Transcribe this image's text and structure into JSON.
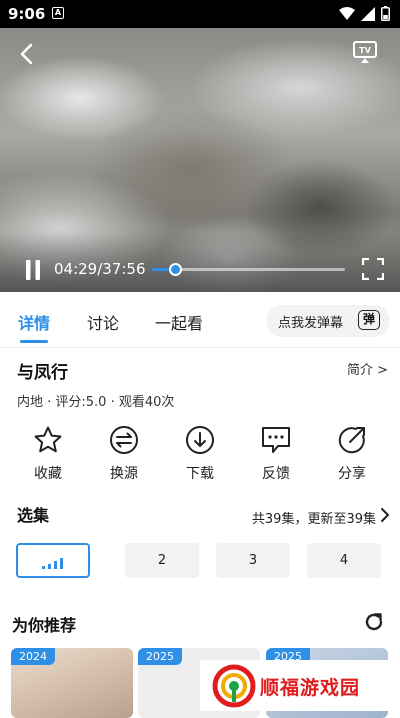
{
  "status_bar": {
    "time": "9:06",
    "notification_icon": "A"
  },
  "player": {
    "time": "04:29/37:56",
    "progress_fraction": 0.118,
    "icons": [
      "back-icon",
      "cast-tv-icon",
      "pause-icon",
      "fullscreen-icon"
    ]
  },
  "tabs": [
    {
      "label": "详情",
      "active": true
    },
    {
      "label": "讨论",
      "active": false
    },
    {
      "label": "一起看",
      "active": false
    }
  ],
  "danmu": {
    "placeholder": "点我发弹幕",
    "badge": "弹"
  },
  "show": {
    "title": "与凤行",
    "intro_link": "简介 >",
    "meta": "内地 · 评分:5.0 · 观看40次"
  },
  "actions": [
    {
      "label": "收藏",
      "icon": "star-icon"
    },
    {
      "label": "换源",
      "icon": "switch-source-icon"
    },
    {
      "label": "下载",
      "icon": "download-icon"
    },
    {
      "label": "反馈",
      "icon": "feedback-icon"
    },
    {
      "label": "分享",
      "icon": "share-icon"
    }
  ],
  "episodes": {
    "title": "选集",
    "summary": "共39集，更新至39集",
    "items": [
      "",
      "2",
      "3",
      "4"
    ],
    "playing_index": 0
  },
  "recommend": {
    "title": "为你推荐",
    "cards": [
      {
        "year": "2024"
      },
      {
        "year": "2025"
      },
      {
        "year": "2025"
      }
    ]
  },
  "watermark": {
    "text": "顺福游戏园"
  },
  "colors": {
    "accent": "#2f8fe6",
    "watermark": "#e01c1c"
  }
}
